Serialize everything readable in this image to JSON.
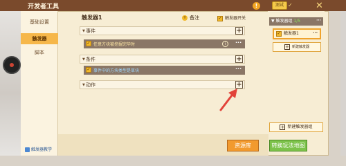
{
  "window": {
    "title": "开发者工具",
    "test_label": "测试",
    "warn_symbol": "!",
    "close_symbol": "✕"
  },
  "sidebar": {
    "items": [
      {
        "label": "基础设置"
      },
      {
        "label": "触发器"
      },
      {
        "label": "脚本"
      }
    ],
    "help_label": "触发器教学"
  },
  "editor": {
    "title": "触发器1",
    "remark_label": "备注",
    "switch_label": "触发器开关",
    "sections": {
      "event": {
        "label": "事件",
        "item": "任意方块被挖掘完毕时"
      },
      "condition": {
        "label": "条件",
        "item": "事件中的方块类型是草块"
      },
      "action": {
        "label": "动作"
      }
    },
    "plus": "+",
    "more": "···",
    "info": "i",
    "check": "✓"
  },
  "right_panel": {
    "group_name": "触发器组",
    "group_count": "1/5",
    "trigger_item": "触发器1",
    "new_trigger": "新建触发器",
    "new_group": "新建触发器组"
  },
  "bottom": {
    "library_button": "资源库",
    "map_button": "转换玩法地图"
  },
  "colors": {
    "titlebar": "#7a4a2c",
    "accent": "#f6b74a",
    "library_button": "#f29a2e",
    "map_button": "#7cc24a",
    "arrow": "#e2433a"
  }
}
